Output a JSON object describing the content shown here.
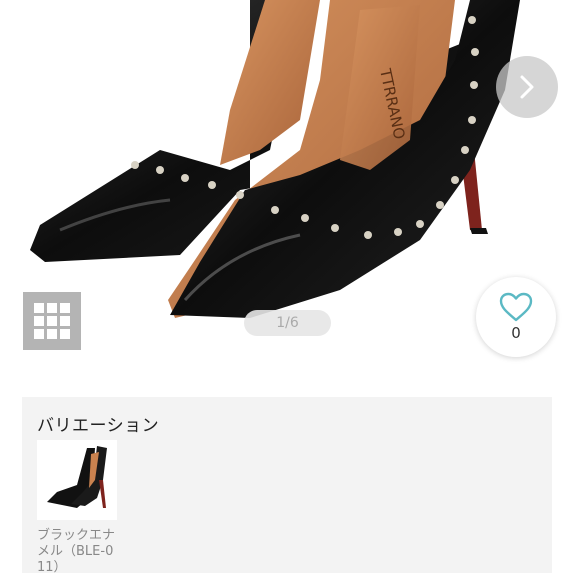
{
  "gallery": {
    "brand_text": "TTRRANO",
    "counter": "1/6",
    "next_icon": "chevron-right-icon",
    "grid_icon": "grid-icon"
  },
  "favorite": {
    "icon": "heart-icon",
    "count": "0"
  },
  "variation": {
    "title": "バリエーション",
    "items": [
      {
        "label": "ブラックエナメル（BLE-011）"
      }
    ]
  },
  "colors": {
    "shoe": "#111111",
    "lining": "#c9824f",
    "sole": "#8b2a22",
    "stud": "#d8d2c4",
    "accent_heart": "#5bb9c4"
  }
}
